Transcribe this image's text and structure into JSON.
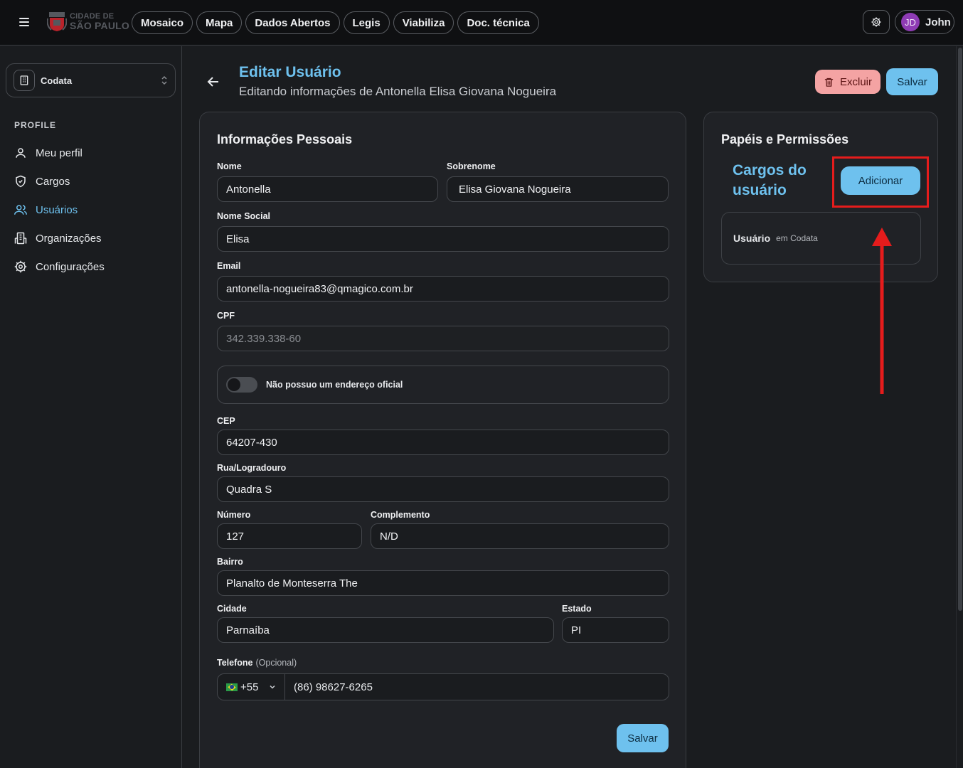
{
  "topbar": {
    "logo": {
      "line1": "CIDADE DE",
      "line2": "SÃO PAULO"
    },
    "nav": [
      "Mosaico",
      "Mapa",
      "Dados Abertos",
      "Legis",
      "Viabiliza",
      "Doc. técnica"
    ],
    "user": {
      "initials": "JD",
      "name": "John"
    }
  },
  "sidebar": {
    "org": "Codata",
    "section": "PROFILE",
    "items": [
      {
        "label": "Meu perfil",
        "icon": "user-icon"
      },
      {
        "label": "Cargos",
        "icon": "shield-icon"
      },
      {
        "label": "Usuários",
        "icon": "users-icon",
        "active": true
      },
      {
        "label": "Organizações",
        "icon": "building-icon"
      },
      {
        "label": "Configurações",
        "icon": "gear-icon"
      }
    ]
  },
  "header": {
    "title": "Editar Usuário",
    "subtitle": "Editando informações de Antonella Elisa Giovana Nogueira",
    "delete_label": "Excluir",
    "save_label": "Salvar"
  },
  "personal": {
    "title": "Informações Pessoais",
    "nome": {
      "label": "Nome",
      "value": "Antonella"
    },
    "sobrenome": {
      "label": "Sobrenome",
      "value": "Elisa Giovana Nogueira"
    },
    "nome_social": {
      "label": "Nome Social",
      "value": "Elisa"
    },
    "email": {
      "label": "Email",
      "value": "antonella-nogueira83@qmagico.com.br"
    },
    "cpf": {
      "label": "CPF",
      "value": "342.339.338-60"
    },
    "no_address": {
      "label": "Não possuo um endereço oficial",
      "checked": false
    },
    "cep": {
      "label": "CEP",
      "value": "64207-430"
    },
    "rua": {
      "label": "Rua/Logradouro",
      "value": "Quadra S"
    },
    "numero": {
      "label": "Número",
      "value": "127"
    },
    "complemento": {
      "label": "Complemento",
      "value": "N/D"
    },
    "bairro": {
      "label": "Bairro",
      "value": "Planalto de Monteserra The"
    },
    "cidade": {
      "label": "Cidade",
      "value": "Parnaíba"
    },
    "estado": {
      "label": "Estado",
      "value": "PI"
    },
    "telefone": {
      "label": "Telefone",
      "optional": "(Opcional)",
      "country_code": "+55",
      "value": "(86) 98627-6265"
    },
    "save_label": "Salvar"
  },
  "roles": {
    "title": "Papéis e Permissões",
    "subtitle_line1": "Cargos do",
    "subtitle_line2": "usuário",
    "add_label": "Adicionar",
    "items": [
      {
        "role": "Usuário",
        "org": "em Codata"
      }
    ]
  },
  "colors": {
    "accent": "#6ec1ee",
    "danger_bg": "#f4a3a3",
    "annotation": "#e51c1c",
    "avatar": "#8e3bb4"
  }
}
